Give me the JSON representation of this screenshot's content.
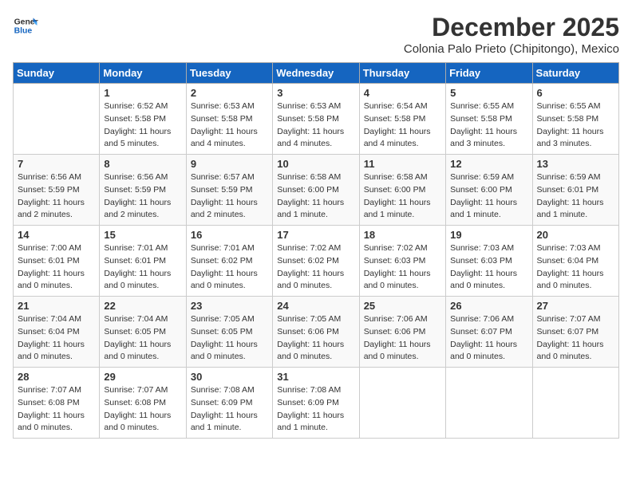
{
  "logo": {
    "general": "General",
    "blue": "Blue"
  },
  "title": "December 2025",
  "subtitle": "Colonia Palo Prieto (Chipitongo), Mexico",
  "headers": [
    "Sunday",
    "Monday",
    "Tuesday",
    "Wednesday",
    "Thursday",
    "Friday",
    "Saturday"
  ],
  "weeks": [
    [
      {
        "day": "",
        "info": ""
      },
      {
        "day": "1",
        "info": "Sunrise: 6:52 AM\nSunset: 5:58 PM\nDaylight: 11 hours\nand 5 minutes."
      },
      {
        "day": "2",
        "info": "Sunrise: 6:53 AM\nSunset: 5:58 PM\nDaylight: 11 hours\nand 4 minutes."
      },
      {
        "day": "3",
        "info": "Sunrise: 6:53 AM\nSunset: 5:58 PM\nDaylight: 11 hours\nand 4 minutes."
      },
      {
        "day": "4",
        "info": "Sunrise: 6:54 AM\nSunset: 5:58 PM\nDaylight: 11 hours\nand 4 minutes."
      },
      {
        "day": "5",
        "info": "Sunrise: 6:55 AM\nSunset: 5:58 PM\nDaylight: 11 hours\nand 3 minutes."
      },
      {
        "day": "6",
        "info": "Sunrise: 6:55 AM\nSunset: 5:58 PM\nDaylight: 11 hours\nand 3 minutes."
      }
    ],
    [
      {
        "day": "7",
        "info": "Sunrise: 6:56 AM\nSunset: 5:59 PM\nDaylight: 11 hours\nand 2 minutes."
      },
      {
        "day": "8",
        "info": "Sunrise: 6:56 AM\nSunset: 5:59 PM\nDaylight: 11 hours\nand 2 minutes."
      },
      {
        "day": "9",
        "info": "Sunrise: 6:57 AM\nSunset: 5:59 PM\nDaylight: 11 hours\nand 2 minutes."
      },
      {
        "day": "10",
        "info": "Sunrise: 6:58 AM\nSunset: 6:00 PM\nDaylight: 11 hours\nand 1 minute."
      },
      {
        "day": "11",
        "info": "Sunrise: 6:58 AM\nSunset: 6:00 PM\nDaylight: 11 hours\nand 1 minute."
      },
      {
        "day": "12",
        "info": "Sunrise: 6:59 AM\nSunset: 6:00 PM\nDaylight: 11 hours\nand 1 minute."
      },
      {
        "day": "13",
        "info": "Sunrise: 6:59 AM\nSunset: 6:01 PM\nDaylight: 11 hours\nand 1 minute."
      }
    ],
    [
      {
        "day": "14",
        "info": "Sunrise: 7:00 AM\nSunset: 6:01 PM\nDaylight: 11 hours\nand 0 minutes."
      },
      {
        "day": "15",
        "info": "Sunrise: 7:01 AM\nSunset: 6:01 PM\nDaylight: 11 hours\nand 0 minutes."
      },
      {
        "day": "16",
        "info": "Sunrise: 7:01 AM\nSunset: 6:02 PM\nDaylight: 11 hours\nand 0 minutes."
      },
      {
        "day": "17",
        "info": "Sunrise: 7:02 AM\nSunset: 6:02 PM\nDaylight: 11 hours\nand 0 minutes."
      },
      {
        "day": "18",
        "info": "Sunrise: 7:02 AM\nSunset: 6:03 PM\nDaylight: 11 hours\nand 0 minutes."
      },
      {
        "day": "19",
        "info": "Sunrise: 7:03 AM\nSunset: 6:03 PM\nDaylight: 11 hours\nand 0 minutes."
      },
      {
        "day": "20",
        "info": "Sunrise: 7:03 AM\nSunset: 6:04 PM\nDaylight: 11 hours\nand 0 minutes."
      }
    ],
    [
      {
        "day": "21",
        "info": "Sunrise: 7:04 AM\nSunset: 6:04 PM\nDaylight: 11 hours\nand 0 minutes."
      },
      {
        "day": "22",
        "info": "Sunrise: 7:04 AM\nSunset: 6:05 PM\nDaylight: 11 hours\nand 0 minutes."
      },
      {
        "day": "23",
        "info": "Sunrise: 7:05 AM\nSunset: 6:05 PM\nDaylight: 11 hours\nand 0 minutes."
      },
      {
        "day": "24",
        "info": "Sunrise: 7:05 AM\nSunset: 6:06 PM\nDaylight: 11 hours\nand 0 minutes."
      },
      {
        "day": "25",
        "info": "Sunrise: 7:06 AM\nSunset: 6:06 PM\nDaylight: 11 hours\nand 0 minutes."
      },
      {
        "day": "26",
        "info": "Sunrise: 7:06 AM\nSunset: 6:07 PM\nDaylight: 11 hours\nand 0 minutes."
      },
      {
        "day": "27",
        "info": "Sunrise: 7:07 AM\nSunset: 6:07 PM\nDaylight: 11 hours\nand 0 minutes."
      }
    ],
    [
      {
        "day": "28",
        "info": "Sunrise: 7:07 AM\nSunset: 6:08 PM\nDaylight: 11 hours\nand 0 minutes."
      },
      {
        "day": "29",
        "info": "Sunrise: 7:07 AM\nSunset: 6:08 PM\nDaylight: 11 hours\nand 0 minutes."
      },
      {
        "day": "30",
        "info": "Sunrise: 7:08 AM\nSunset: 6:09 PM\nDaylight: 11 hours\nand 1 minute."
      },
      {
        "day": "31",
        "info": "Sunrise: 7:08 AM\nSunset: 6:09 PM\nDaylight: 11 hours\nand 1 minute."
      },
      {
        "day": "",
        "info": ""
      },
      {
        "day": "",
        "info": ""
      },
      {
        "day": "",
        "info": ""
      }
    ]
  ]
}
